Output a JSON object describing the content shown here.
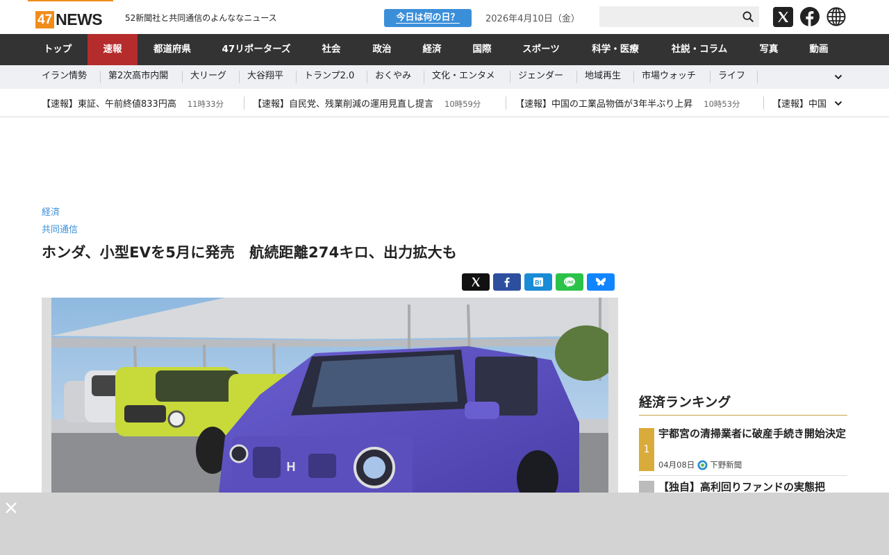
{
  "header": {
    "logo_num": "47",
    "logo_word": "NEWS",
    "tagline": "52新聞社と共同通信のよんななニュース",
    "today_label": "今日は何の日？",
    "date": "2026年4月10日（金）",
    "search_placeholder": ""
  },
  "main_nav": [
    {
      "label": "トップ"
    },
    {
      "label": "速報",
      "active": true
    },
    {
      "label": "都道府県"
    },
    {
      "label": "47リポーターズ"
    },
    {
      "label": "社会"
    },
    {
      "label": "政治"
    },
    {
      "label": "経済"
    },
    {
      "label": "国際"
    },
    {
      "label": "スポーツ"
    },
    {
      "label": "科学・医療"
    },
    {
      "label": "社説・コラム"
    },
    {
      "label": "写真"
    },
    {
      "label": "動画"
    }
  ],
  "sub_nav": [
    {
      "label": "イラン情勢"
    },
    {
      "label": "第2次高市内閣"
    },
    {
      "label": "大リーグ"
    },
    {
      "label": "大谷翔平"
    },
    {
      "label": "トランプ2.0"
    },
    {
      "label": "おくやみ"
    },
    {
      "label": "文化・エンタメ"
    },
    {
      "label": "ジェンダー"
    },
    {
      "label": "地域再生"
    },
    {
      "label": "市場ウォッチ"
    },
    {
      "label": "ライフ"
    }
  ],
  "ticker": [
    {
      "text": "【速報】東証、午前終値833円高",
      "time": "11時33分"
    },
    {
      "text": "【速報】自民党、残業削減の運用見直し提言",
      "time": "10時59分"
    },
    {
      "text": "【速報】中国の工業品物価が3年半ぶり上昇",
      "time": "10時53分"
    },
    {
      "text": "【速報】中国"
    }
  ],
  "article": {
    "category": "経済",
    "source": "共同通信",
    "headline": "ホンダ、小型EVを5月に発売　航続距離274キロ、出力拡大も"
  },
  "ranking": {
    "title": "経済ランキング",
    "items": [
      {
        "rank": "1",
        "title": "宇都宮の清掃業者に破産手続き開始決定",
        "date": "04月08日",
        "publisher": "下野新聞"
      },
      {
        "title": "【独自】高利回りファンドの実態把"
      }
    ]
  },
  "colors": {
    "brand_orange": "#f08c1a",
    "nav_bg": "#333333",
    "nav_active": "#b52c2c",
    "link_blue": "#3b8fd9",
    "rank_gold": "#d9ab3a"
  }
}
